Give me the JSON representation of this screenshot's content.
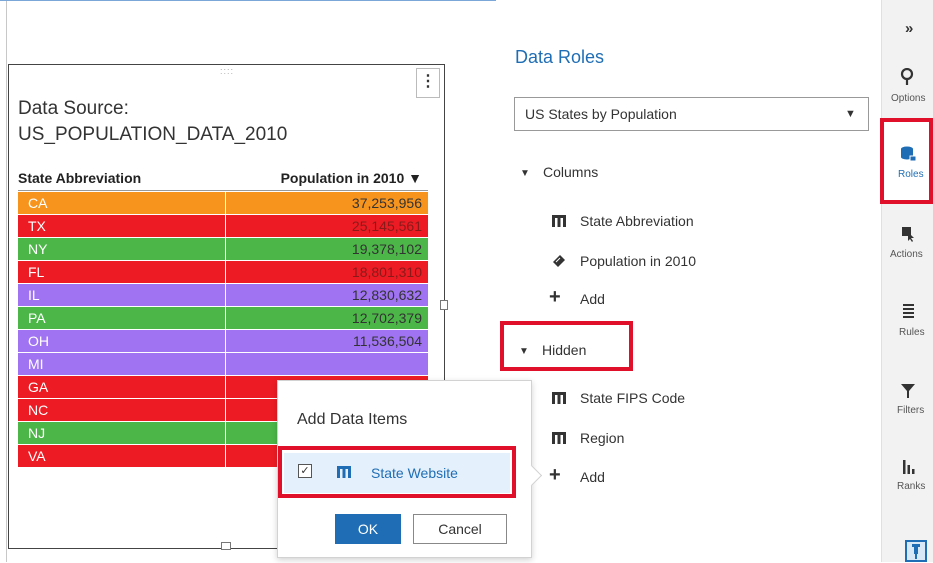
{
  "canvas": {
    "data_source_label": "Data Source:",
    "data_source_name": "US_POPULATION_DATA_2010",
    "grip_glyph": "::::",
    "kebab_glyph": "⋮",
    "table": {
      "columns": [
        "State Abbreviation",
        "Population in 2010 ▼"
      ],
      "rows": [
        {
          "state": "CA",
          "population": "37,253,956",
          "color": "#f7941d"
        },
        {
          "state": "TX",
          "population": "25,145,561",
          "color": "#ed1c24"
        },
        {
          "state": "NY",
          "population": "19,378,102",
          "color": "#4cb748"
        },
        {
          "state": "FL",
          "population": "18,801,310",
          "color": "#ed1c24"
        },
        {
          "state": "IL",
          "population": "12,830,632",
          "color": "#9f73f2"
        },
        {
          "state": "PA",
          "population": "12,702,379",
          "color": "#4cb748"
        },
        {
          "state": "OH",
          "population": "11,536,504",
          "color": "#9f73f2"
        },
        {
          "state": "MI",
          "population": "",
          "color": "#9f73f2"
        },
        {
          "state": "GA",
          "population": "",
          "color": "#ed1c24"
        },
        {
          "state": "NC",
          "population": "",
          "color": "#ed1c24"
        },
        {
          "state": "NJ",
          "population": "",
          "color": "#4cb748"
        },
        {
          "state": "VA",
          "population": "",
          "color": "#ed1c24"
        }
      ]
    }
  },
  "popup": {
    "title": "Add Data Items",
    "item_checked": true,
    "item_label": "State Website",
    "ok_label": "OK",
    "cancel_label": "Cancel"
  },
  "data_roles": {
    "title": "Data Roles",
    "data_source_selected": "US States by Population",
    "columns_section": {
      "label": "Columns",
      "items": [
        "State Abbreviation",
        "Population in 2010"
      ],
      "add_label": "Add"
    },
    "hidden_section": {
      "label": "Hidden",
      "items": [
        "State FIPS Code",
        "Region"
      ],
      "add_label": "Add"
    }
  },
  "rail": {
    "collapse_glyph": "»",
    "items": [
      {
        "label": "Options",
        "icon": "options-icon"
      },
      {
        "label": "Roles",
        "icon": "roles-icon",
        "selected": true
      },
      {
        "label": "Actions",
        "icon": "actions-icon"
      },
      {
        "label": "Rules",
        "icon": "rules-icon"
      },
      {
        "label": "Filters",
        "icon": "filters-icon"
      },
      {
        "label": "Ranks",
        "icon": "ranks-icon"
      }
    ]
  },
  "colors": {
    "accent": "#1f6eb5",
    "highlight_box": "#e0102b",
    "orange": "#f7941d",
    "red": "#ed1c24",
    "green": "#4cb748",
    "purple": "#9f73f2"
  }
}
